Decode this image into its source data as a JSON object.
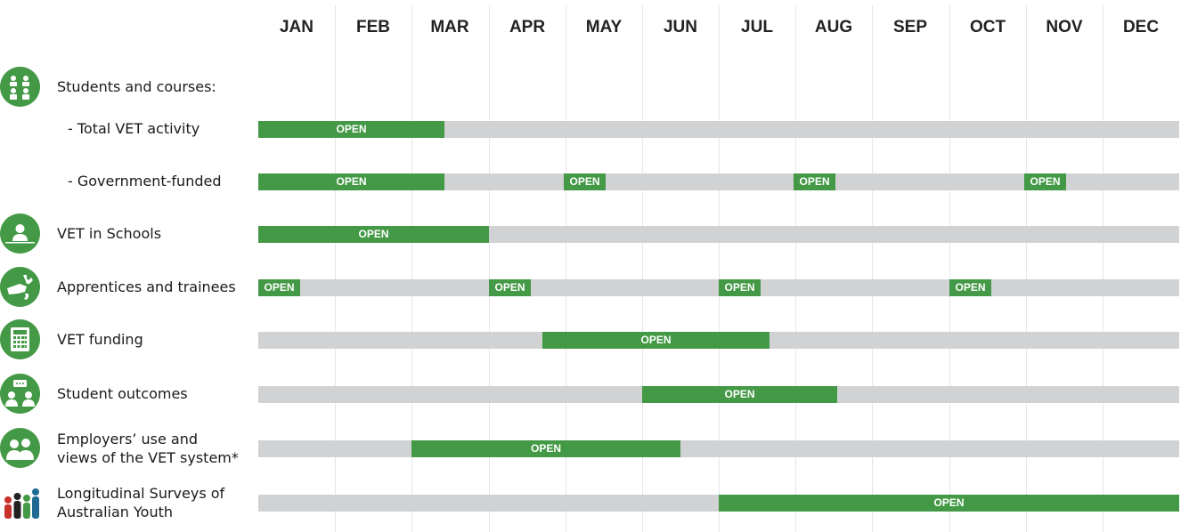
{
  "chart_data": {
    "type": "gantt",
    "title": "",
    "x_axis": {
      "unit": "month",
      "range": [
        0,
        12
      ],
      "tick_labels": [
        "JAN",
        "FEB",
        "MAR",
        "APR",
        "MAY",
        "JUN",
        "JUL",
        "AUG",
        "SEP",
        "OCT",
        "NOV",
        "DEC"
      ],
      "gridlines": true
    },
    "bar_label": "OPEN",
    "colors": {
      "open": "#439945",
      "closed": "#d1d2d4",
      "grid": "#e6e6e6"
    },
    "rows": [
      {
        "name": "students-courses",
        "label": "Students and courses:",
        "icon": "students-icon",
        "header_only": true,
        "open_periods": []
      },
      {
        "name": "total-vet-activity",
        "label": "- Total VET activity",
        "sub": true,
        "open_periods": [
          [
            0,
            2.42
          ]
        ]
      },
      {
        "name": "government-funded",
        "label": "- Government-funded",
        "sub": true,
        "open_periods": [
          [
            0,
            2.42
          ],
          [
            3.98,
            4.53
          ],
          [
            6.98,
            7.53
          ],
          [
            9.98,
            10.53
          ]
        ]
      },
      {
        "name": "vet-in-schools",
        "label": "VET in Schools",
        "icon": "teacher-icon",
        "open_periods": [
          [
            0,
            3.0
          ]
        ]
      },
      {
        "name": "apprentices-trainees",
        "label": "Apprentices and trainees",
        "icon": "wrench-hand-icon",
        "open_periods": [
          [
            0,
            0.55
          ],
          [
            3.0,
            3.55
          ],
          [
            6.0,
            6.55
          ],
          [
            9.0,
            9.55
          ]
        ]
      },
      {
        "name": "vet-funding",
        "label": "VET funding",
        "icon": "calculator-icon",
        "open_periods": [
          [
            3.7,
            6.66
          ]
        ]
      },
      {
        "name": "student-outcomes",
        "label": "Student outcomes",
        "icon": "people-chat-icon",
        "open_periods": [
          [
            5.0,
            7.54
          ]
        ]
      },
      {
        "name": "employers-use-views",
        "label": "Employers’ use and views of the VET system*",
        "label_lines": [
          "Employers’ use and",
          "views of the VET system*"
        ],
        "icon": "employers-icon",
        "open_periods": [
          [
            2.0,
            5.51
          ]
        ]
      },
      {
        "name": "lsay",
        "label": "Longitudinal Surveys of Australian Youth",
        "label_lines": [
          "Longitudinal Surveys of",
          "Australian Youth"
        ],
        "icon": "lsay-logo-icon",
        "open_periods": [
          [
            6.0,
            12.0
          ]
        ]
      }
    ]
  }
}
